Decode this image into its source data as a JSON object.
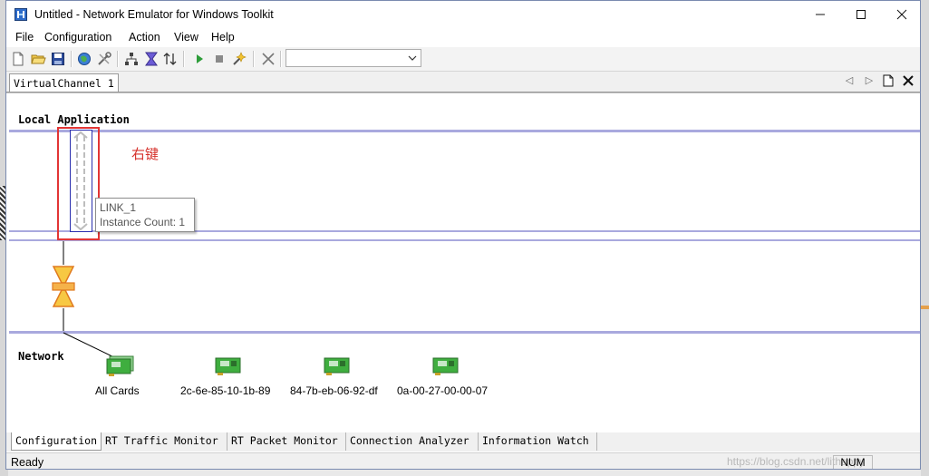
{
  "window": {
    "title": "Untitled - Network Emulator for Windows Toolkit"
  },
  "menu": [
    "File",
    "Configuration",
    "Action",
    "View",
    "Help"
  ],
  "toolbar": {
    "icons": [
      "new-file-icon",
      "open-folder-icon",
      "save-icon",
      "globe-icon",
      "tools-icon",
      "network-topology-icon",
      "filter-icon",
      "sort-icon",
      "play-icon",
      "stop-icon",
      "wizard-icon",
      "disconnect-icon"
    ],
    "combo_value": ""
  },
  "doc_tab": {
    "label": "VirtualChannel 1"
  },
  "canvas": {
    "local_application_label": "Local Application",
    "network_label": "Network",
    "annotation": "右键",
    "tooltip": {
      "line1": "LINK_1",
      "line2": "Instance Count: 1"
    },
    "cards": [
      {
        "label": "All Cards"
      },
      {
        "label": "2c-6e-85-10-1b-89"
      },
      {
        "label": "84-7b-eb-06-92-df"
      },
      {
        "label": "0a-00-27-00-00-07"
      }
    ]
  },
  "bottom_tabs": [
    "Configuration",
    "RT Traffic Monitor",
    "RT Packet Monitor",
    "Connection Analyzer",
    "Information Watch"
  ],
  "status": {
    "text": "Ready",
    "num": "NUM",
    "watermark": "https://blog.csdn.net/lithappy"
  },
  "colors": {
    "accent_line": "#a9a9de",
    "annotation_red": "#e23535",
    "link_blue": "#2a2fae",
    "card_green": "#3fae3f"
  }
}
